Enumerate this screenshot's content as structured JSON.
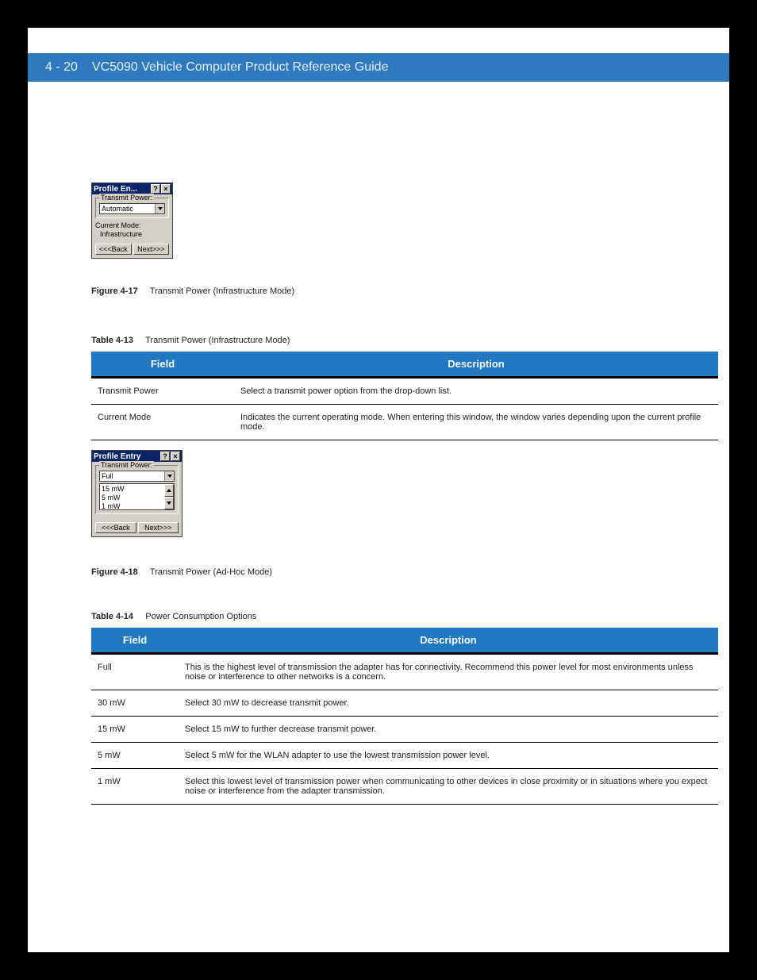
{
  "header": {
    "page_number": "4 - 20",
    "title": "VC5090 Vehicle Computer Product Reference Guide"
  },
  "dialog1": {
    "title": "Profile En...",
    "help": "?",
    "close": "×",
    "group_label": "Transmit Power:",
    "combo_value": "Automatic",
    "mode_label": "Current Mode:",
    "mode_value": "Infrastructure",
    "back": "<<<Back",
    "next": "Next>>>"
  },
  "fig1": {
    "label": "Figure 4-17",
    "text": "Transmit Power (Infrastructure Mode)"
  },
  "tblcap1": {
    "label": "Table 4-13",
    "text": "Transmit Power (Infrastructure Mode)"
  },
  "table1": {
    "headers": {
      "field": "Field",
      "desc": "Description"
    },
    "rows": [
      {
        "field": "Transmit Power",
        "desc": "Select a transmit power option from the drop-down list."
      },
      {
        "field": "Current Mode",
        "desc": "Indicates the current operating mode. When entering this window, the window varies depending upon the current profile mode."
      }
    ]
  },
  "dialog2": {
    "title": "Profile Entry",
    "help": "?",
    "close": "×",
    "group_label": "Transmit Power:",
    "combo_value": "Full",
    "list": [
      "15 mW",
      "5 mW",
      "1 mW"
    ],
    "back": "<<<Back",
    "next": "Next>>>"
  },
  "fig2": {
    "label": "Figure 4-18",
    "text": "Transmit Power (Ad-Hoc Mode)"
  },
  "tblcap2": {
    "label": "Table 4-14",
    "text": "Power Consumption Options"
  },
  "table2": {
    "headers": {
      "field": "Field",
      "desc": "Description"
    },
    "rows": [
      {
        "field": "Full",
        "desc": "This is the highest level of transmission the adapter has for connectivity. Recommend this power level for most environments unless noise or interference to other networks is a concern."
      },
      {
        "field": "30 mW",
        "desc": "Select 30 mW to decrease transmit power."
      },
      {
        "field": "15 mW",
        "desc": "Select 15 mW to further decrease transmit power."
      },
      {
        "field": "5 mW",
        "desc": "Select 5 mW for the WLAN adapter to use the lowest transmission power level."
      },
      {
        "field": "1 mW",
        "desc": "Select this lowest level of transmission power when communicating to other devices in close proximity or in situations where you expect noise or interference from the adapter transmission."
      }
    ]
  }
}
